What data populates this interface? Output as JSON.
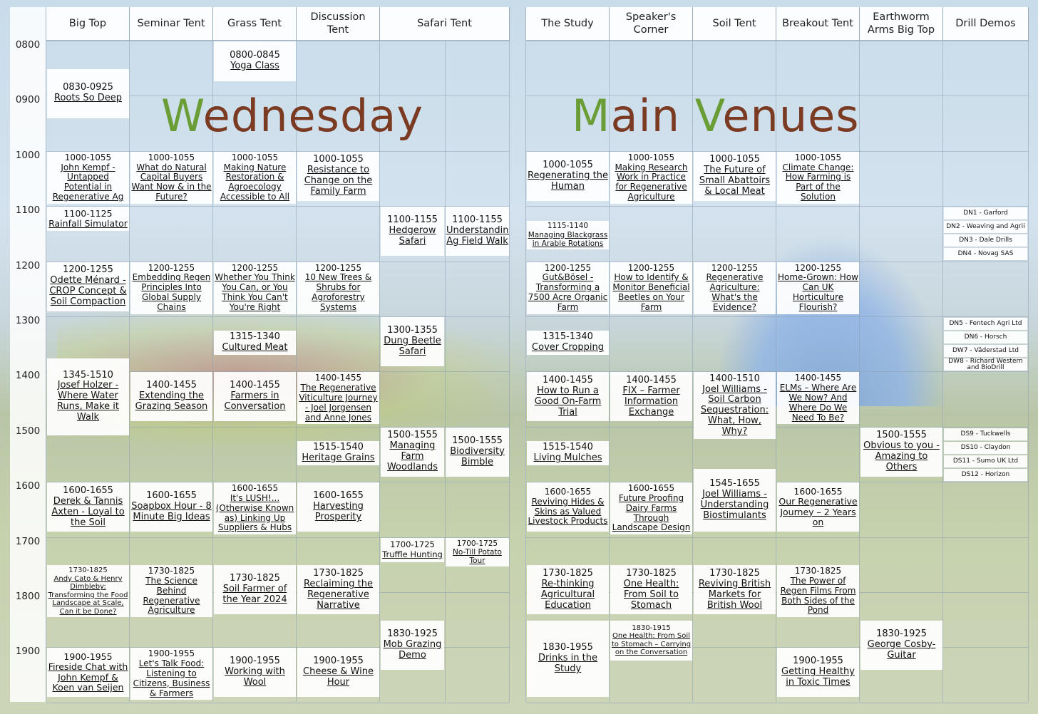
{
  "titles": {
    "left": "Wednesday",
    "right": "Main Venues"
  },
  "colors": {
    "title_green": "#6a9d36",
    "title_brown": "#7b3a22"
  },
  "times": [
    "0800",
    "0900",
    "1000",
    "1100",
    "1200",
    "1300",
    "1400",
    "1500",
    "1600",
    "1700",
    "1800",
    "1900"
  ],
  "left_venues": [
    {
      "name": "Big Top",
      "events": [
        {
          "time": "0830-0925",
          "title": "Roots So Deep"
        },
        {
          "time": "1000-1055",
          "title": "John Kempf - Untapped Potential in Regenerative Ag"
        },
        {
          "time": "1100-1125",
          "title": "Rainfall Simulator"
        },
        {
          "time": "1200-1255",
          "title": "Odette Ménard - CROP Concept & Soil Compaction"
        },
        {
          "time": "1345-1510",
          "title": "Josef Holzer - Where Water Runs, Make it Walk"
        },
        {
          "time": "1600-1655",
          "title": "Derek & Tannis Axten - Loyal to the Soil"
        },
        {
          "time": "1730-1825",
          "title": "Andy Cato & Henry Dimbleby: Transforming the Food Landscape at Scale, Can it be Done?"
        },
        {
          "time": "1900-1955",
          "title": "Fireside Chat with John Kempf & Koen van Seijen"
        }
      ]
    },
    {
      "name": "Seminar Tent",
      "events": [
        {
          "time": "1000-1055",
          "title": "What do Natural Capital Buyers Want Now & in the Future?"
        },
        {
          "time": "1200-1255",
          "title": "Embedding Regen Principles Into Global Supply Chains"
        },
        {
          "time": "1400-1455",
          "title": "Extending the Grazing Season"
        },
        {
          "time": "1600-1655",
          "title": "Soapbox Hour - 8 Minute Big Ideas"
        },
        {
          "time": "1730-1825",
          "title": "The Science Behind Regenerative Agriculture"
        },
        {
          "time": "1900-1955",
          "title": "Let's Talk Food: Listening to Citizens, Business & Farmers"
        }
      ]
    },
    {
      "name": "Grass Tent",
      "events": [
        {
          "time": "0800-0845",
          "title": "Yoga Class"
        },
        {
          "time": "1000-1055",
          "title": "Making Nature Restoration & Agroecology Accessible to All"
        },
        {
          "time": "1200-1255",
          "title": "Whether You Think You Can, or You Think You Can't You're Right"
        },
        {
          "time": "1315-1340",
          "title": "Cultured Meat"
        },
        {
          "time": "1400-1455",
          "title": "Farmers in Conversation"
        },
        {
          "time": "1600-1655",
          "title": "It's LUSH!... (Otherwise Known as) Linking Up Suppliers & Hubs"
        },
        {
          "time": "1730-1825",
          "title": "Soil Farmer of the Year 2024"
        },
        {
          "time": "1900-1955",
          "title": "Working with Wool"
        }
      ]
    },
    {
      "name": "Discussion Tent",
      "events": [
        {
          "time": "1000-1055",
          "title": "Resistance to Change on the Family Farm"
        },
        {
          "time": "1200-1255",
          "title": "10 New Trees & Shrubs for Agroforestry Systems"
        },
        {
          "time": "1400-1455",
          "title": "The Regenerative Viticulture Journey - Joel Jorgensen and Anne Jones"
        },
        {
          "time": "1515-1540",
          "title": "Heritage Grains"
        },
        {
          "time": "1600-1655",
          "title": "Harvesting Prosperity"
        },
        {
          "time": "1730-1825",
          "title": "Reclaiming the Regenerative Narrative"
        },
        {
          "time": "1900-1955",
          "title": "Cheese & Wine Hour"
        }
      ]
    },
    {
      "name": "Safari Tent",
      "wide": true,
      "events": [
        {
          "time": "1100-1155",
          "title": "Hedgerow Safari",
          "track": 0
        },
        {
          "time": "1100-1155",
          "title": "Understanding Ag Field Walk",
          "track": 1
        },
        {
          "time": "1300-1355",
          "title": "Dung Beetle Safari",
          "track": 0
        },
        {
          "time": "1500-1555",
          "title": "Managing Farm Woodlands",
          "track": 0
        },
        {
          "time": "1500-1555",
          "title": "Biodiversity Bimble",
          "track": 1
        },
        {
          "time": "1700-1725",
          "title": "Truffle Hunting",
          "track": 0
        },
        {
          "time": "1700-1725",
          "title": "No-Till Potato Tour",
          "track": 1
        },
        {
          "time": "1830-1925",
          "title": "Mob Grazing Demo",
          "track": 0
        }
      ]
    }
  ],
  "right_venues": [
    {
      "name": "The Study",
      "events": [
        {
          "time": "1000-1055",
          "title": "Regenerating the Human"
        },
        {
          "time": "1115-1140",
          "title": "Managing Blackgrass in Arable Rotations"
        },
        {
          "time": "1200-1255",
          "title": "Gut&Bösel - Transforming a 7500 Acre Organic Farm"
        },
        {
          "time": "1315-1340",
          "title": "Cover Cropping"
        },
        {
          "time": "1400-1455",
          "title": "How to Run a Good On-Farm Trial"
        },
        {
          "time": "1515-1540",
          "title": "Living Mulches"
        },
        {
          "time": "1600-1655",
          "title": "Reviving Hides & Skins as Valued Livestock Products"
        },
        {
          "time": "1730-1825",
          "title": "Re-thinking Agricultural Education"
        },
        {
          "time": "1830-1955",
          "title": "Drinks in the Study"
        }
      ]
    },
    {
      "name": "Speaker's Corner",
      "events": [
        {
          "time": "1000-1055",
          "title": "Making Research Work in Practice for Regenerative Agriculture"
        },
        {
          "time": "1200-1255",
          "title": "How to Identify & Monitor Beneficial Beetles on Your Farm"
        },
        {
          "time": "1400-1455",
          "title": "FIX – Farmer Information Exchange"
        },
        {
          "time": "1600-1655",
          "title": "Future Proofing Dairy Farms Through Landscape Design"
        },
        {
          "time": "1730-1825",
          "title": "One Health: From Soil to Stomach"
        },
        {
          "time": "1830-1915",
          "title": "One Health: From Soil to Stomach – Carrying on the Conversation"
        }
      ]
    },
    {
      "name": "Soil Tent",
      "events": [
        {
          "time": "1000-1055",
          "title": "The Future of Small Abattoirs & Local Meat"
        },
        {
          "time": "1200-1255",
          "title": "Regenerative Agriculture: What's the Evidence?"
        },
        {
          "time": "1400-1510",
          "title": "Joel Williams - Soil Carbon Sequestration: What, How, Why?"
        },
        {
          "time": "1545-1655",
          "title": "Joel Williams - Understanding Biostimulants"
        },
        {
          "time": "1730-1825",
          "title": "Reviving British Markets for British Wool"
        }
      ]
    },
    {
      "name": "Breakout Tent",
      "events": [
        {
          "time": "1000-1055",
          "title": "Climate Change: How Farming is Part of the Solution"
        },
        {
          "time": "1200-1255",
          "title": "Home-Grown: How Can UK Horticulture Flourish?"
        },
        {
          "time": "1400-1455",
          "title": "ELMs – Where Are We Now? And Where Do We Need To Be?"
        },
        {
          "time": "1600-1655",
          "title": "Our Regenerative Journey – 2 Years on"
        },
        {
          "time": "1730-1825",
          "title": "The Power of Regen Films From Both Sides of the Pond"
        },
        {
          "time": "1900-1955",
          "title": "Getting Healthy in Toxic Times"
        }
      ]
    },
    {
      "name": "Earthworm Arms Big Top",
      "events": [
        {
          "time": "1500-1555",
          "title": "Obvious to you - Amazing to Others"
        },
        {
          "time": "1830-1925",
          "title": "George Cosby- Guitar"
        }
      ]
    },
    {
      "name": "Drill Demos",
      "drill_groups": [
        [
          "DN1 - Garford",
          "DN2 - Weaving and Agrii",
          "DN3 - Dale Drills",
          "DN4 - Novag SAS"
        ],
        [
          "DN5 - Fentech Agri Ltd",
          "DN6 - Horsch",
          "DW7 - Väderstad Ltd",
          "DW8 - Richard Western and BioDrill"
        ],
        [
          "DS9 - Tuckwells",
          "DS10 - Claydon",
          "DS11 - Sumo UK Ltd",
          "DS12 - Horizon"
        ]
      ]
    }
  ]
}
